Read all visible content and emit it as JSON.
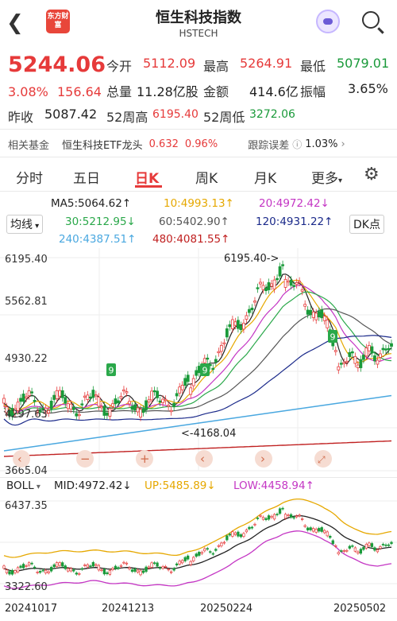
{
  "header": {
    "logo_text": "东方财富",
    "title": "恒生科技指数",
    "subtitle": "HSTECH"
  },
  "quote": {
    "price": "5244.06",
    "pct_change": "3.08%",
    "change": "156.64",
    "open_label": "今开",
    "open": "5112.09",
    "high_label": "最高",
    "high": "5264.91",
    "low_label": "最低",
    "low": "5079.01",
    "volume_label": "总量",
    "volume": "11.28亿股",
    "amount_label": "金额",
    "amount": "414.6亿",
    "amplitude_label": "振幅",
    "amplitude": "3.65%",
    "prev_close_label": "昨收",
    "prev_close": "5087.42",
    "week52_high_label": "52周高",
    "week52_high": "6195.40",
    "week52_low_label": "52周低",
    "week52_low": "3272.06"
  },
  "fund": {
    "label": "相关基金",
    "name": "恒生科技ETF龙头",
    "price": "0.632",
    "pct": "0.96%",
    "tracking_label": "跟踪误差",
    "tracking_value": "1.03%"
  },
  "tabs": [
    "分时",
    "五日",
    "日K",
    "周K",
    "月K",
    "更多"
  ],
  "active_tab": "日K",
  "ma": {
    "ma5": "MA5:5064.62↑",
    "ma10": "10:4993.13↑",
    "ma20": "20:4972.42↓",
    "ma30": "30:5212.95↓",
    "ma60": "60:5402.90↑",
    "ma120": "120:4931.22↑",
    "ma240": "240:4387.51↑",
    "ma480": "480:4081.55↑",
    "indicator": "均线",
    "dk": "DK点"
  },
  "chart": {
    "y_labels": [
      "6195.40",
      "5562.81",
      "4930.22",
      "4297.63",
      "3665.04"
    ],
    "max_callout": "6195.40->",
    "min_callout": "<-4168.04",
    "boll_label": "BOLL",
    "boll_mid": "MID:4972.42↓",
    "boll_up": "UP:5485.89↓",
    "boll_low": "LOW:4458.94↑",
    "boll_y_top": "6437.35",
    "boll_y_bottom": "3322.60",
    "dates": [
      "20241017",
      "20241213",
      "20250224",
      "20250502"
    ],
    "td_signal": "9"
  },
  "colors": {
    "up": "#e63a3a",
    "down": "#1a9a3a",
    "ma5": "#222222",
    "ma10": "#e6a800",
    "ma20": "#c436c4",
    "ma30": "#2aa84a",
    "ma60": "#555555",
    "ma120": "#1b2a8a",
    "ma240": "#4aa8e0",
    "ma480": "#c02020"
  }
}
